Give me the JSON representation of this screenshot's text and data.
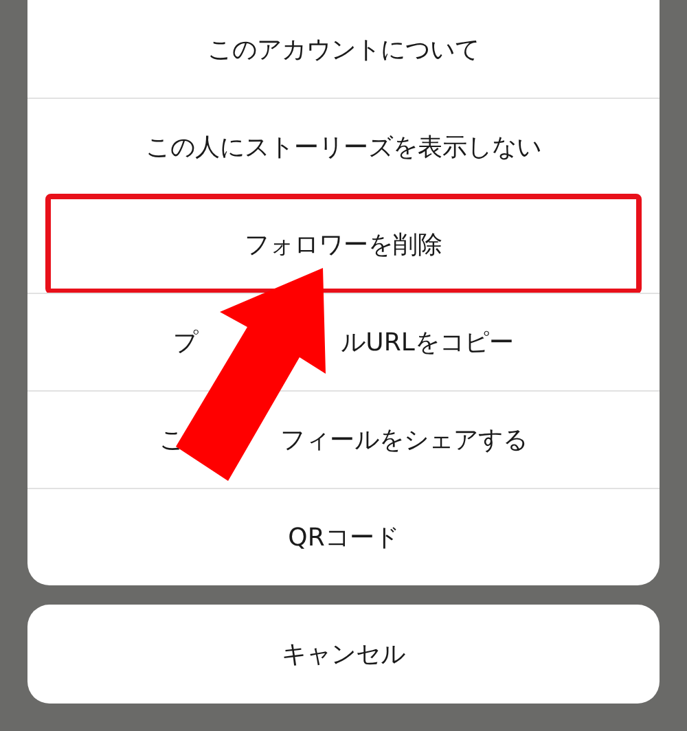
{
  "action_sheet": {
    "items": [
      {
        "parts": [
          "このアカウントについて"
        ],
        "highlighted": false
      },
      {
        "parts": [
          "この人にストーリーズを表示しない"
        ],
        "highlighted": false
      },
      {
        "parts": [
          "フォロワーを削除"
        ],
        "highlighted": true
      },
      {
        "parts": [
          "プ",
          "ルURLをコピー"
        ],
        "highlighted": false
      },
      {
        "parts": [
          "こ",
          "フィールをシェアする"
        ],
        "highlighted": false
      },
      {
        "parts": [
          "QRコード"
        ],
        "highlighted": false
      }
    ]
  },
  "cancel_button": {
    "label": "キャンセル"
  }
}
